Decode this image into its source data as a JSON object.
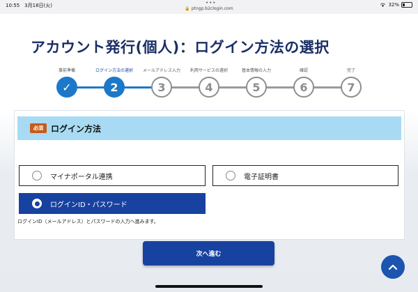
{
  "status_bar": {
    "time": "10:55　3月18日(火)",
    "dots": "•••",
    "url": "🔒 ptngp.b2clogin.com",
    "battery": "32%"
  },
  "page_title": "アカウント発行(個人)：ログイン方法の選択",
  "steps": [
    {
      "label": "事前準備",
      "number": "✓",
      "state": "done"
    },
    {
      "label": "ログイン方法の選択",
      "number": "2",
      "state": "current"
    },
    {
      "label": "メールアドレス入力",
      "number": "3",
      "state": "todo"
    },
    {
      "label": "利用サービスの選択",
      "number": "4",
      "state": "todo"
    },
    {
      "label": "基本情報の入力",
      "number": "5",
      "state": "todo"
    },
    {
      "label": "確認",
      "number": "6",
      "state": "todo"
    },
    {
      "label": "完了",
      "number": "7",
      "state": "todo"
    }
  ],
  "section": {
    "badge": "必須",
    "title": "ログイン方法",
    "options": [
      {
        "label": "マイナポータル連携",
        "selected": false
      },
      {
        "label": "電子証明書",
        "selected": false
      },
      {
        "label": "ログインID・パスワード",
        "selected": true
      }
    ],
    "note": "ログインID（メールアドレス）とパスワードの入力へ進みます。"
  },
  "next_button": "次へ進む",
  "colors": {
    "title": "#1b2f66",
    "accent": "#1c78c8",
    "primary_button": "#1842a0",
    "header_band": "#a8dbf3",
    "badge": "#c75a1a"
  }
}
